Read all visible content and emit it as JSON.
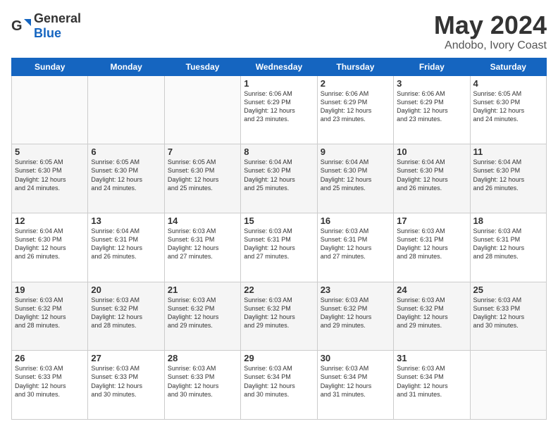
{
  "logo": {
    "general": "General",
    "blue": "Blue"
  },
  "header": {
    "month": "May 2024",
    "location": "Andobo, Ivory Coast"
  },
  "weekdays": [
    "Sunday",
    "Monday",
    "Tuesday",
    "Wednesday",
    "Thursday",
    "Friday",
    "Saturday"
  ],
  "weeks": [
    [
      {
        "num": "",
        "info": ""
      },
      {
        "num": "",
        "info": ""
      },
      {
        "num": "",
        "info": ""
      },
      {
        "num": "1",
        "info": "Sunrise: 6:06 AM\nSunset: 6:29 PM\nDaylight: 12 hours\nand 23 minutes."
      },
      {
        "num": "2",
        "info": "Sunrise: 6:06 AM\nSunset: 6:29 PM\nDaylight: 12 hours\nand 23 minutes."
      },
      {
        "num": "3",
        "info": "Sunrise: 6:06 AM\nSunset: 6:29 PM\nDaylight: 12 hours\nand 23 minutes."
      },
      {
        "num": "4",
        "info": "Sunrise: 6:05 AM\nSunset: 6:30 PM\nDaylight: 12 hours\nand 24 minutes."
      }
    ],
    [
      {
        "num": "5",
        "info": "Sunrise: 6:05 AM\nSunset: 6:30 PM\nDaylight: 12 hours\nand 24 minutes."
      },
      {
        "num": "6",
        "info": "Sunrise: 6:05 AM\nSunset: 6:30 PM\nDaylight: 12 hours\nand 24 minutes."
      },
      {
        "num": "7",
        "info": "Sunrise: 6:05 AM\nSunset: 6:30 PM\nDaylight: 12 hours\nand 25 minutes."
      },
      {
        "num": "8",
        "info": "Sunrise: 6:04 AM\nSunset: 6:30 PM\nDaylight: 12 hours\nand 25 minutes."
      },
      {
        "num": "9",
        "info": "Sunrise: 6:04 AM\nSunset: 6:30 PM\nDaylight: 12 hours\nand 25 minutes."
      },
      {
        "num": "10",
        "info": "Sunrise: 6:04 AM\nSunset: 6:30 PM\nDaylight: 12 hours\nand 26 minutes."
      },
      {
        "num": "11",
        "info": "Sunrise: 6:04 AM\nSunset: 6:30 PM\nDaylight: 12 hours\nand 26 minutes."
      }
    ],
    [
      {
        "num": "12",
        "info": "Sunrise: 6:04 AM\nSunset: 6:30 PM\nDaylight: 12 hours\nand 26 minutes."
      },
      {
        "num": "13",
        "info": "Sunrise: 6:04 AM\nSunset: 6:31 PM\nDaylight: 12 hours\nand 26 minutes."
      },
      {
        "num": "14",
        "info": "Sunrise: 6:03 AM\nSunset: 6:31 PM\nDaylight: 12 hours\nand 27 minutes."
      },
      {
        "num": "15",
        "info": "Sunrise: 6:03 AM\nSunset: 6:31 PM\nDaylight: 12 hours\nand 27 minutes."
      },
      {
        "num": "16",
        "info": "Sunrise: 6:03 AM\nSunset: 6:31 PM\nDaylight: 12 hours\nand 27 minutes."
      },
      {
        "num": "17",
        "info": "Sunrise: 6:03 AM\nSunset: 6:31 PM\nDaylight: 12 hours\nand 28 minutes."
      },
      {
        "num": "18",
        "info": "Sunrise: 6:03 AM\nSunset: 6:31 PM\nDaylight: 12 hours\nand 28 minutes."
      }
    ],
    [
      {
        "num": "19",
        "info": "Sunrise: 6:03 AM\nSunset: 6:32 PM\nDaylight: 12 hours\nand 28 minutes."
      },
      {
        "num": "20",
        "info": "Sunrise: 6:03 AM\nSunset: 6:32 PM\nDaylight: 12 hours\nand 28 minutes."
      },
      {
        "num": "21",
        "info": "Sunrise: 6:03 AM\nSunset: 6:32 PM\nDaylight: 12 hours\nand 29 minutes."
      },
      {
        "num": "22",
        "info": "Sunrise: 6:03 AM\nSunset: 6:32 PM\nDaylight: 12 hours\nand 29 minutes."
      },
      {
        "num": "23",
        "info": "Sunrise: 6:03 AM\nSunset: 6:32 PM\nDaylight: 12 hours\nand 29 minutes."
      },
      {
        "num": "24",
        "info": "Sunrise: 6:03 AM\nSunset: 6:32 PM\nDaylight: 12 hours\nand 29 minutes."
      },
      {
        "num": "25",
        "info": "Sunrise: 6:03 AM\nSunset: 6:33 PM\nDaylight: 12 hours\nand 30 minutes."
      }
    ],
    [
      {
        "num": "26",
        "info": "Sunrise: 6:03 AM\nSunset: 6:33 PM\nDaylight: 12 hours\nand 30 minutes."
      },
      {
        "num": "27",
        "info": "Sunrise: 6:03 AM\nSunset: 6:33 PM\nDaylight: 12 hours\nand 30 minutes."
      },
      {
        "num": "28",
        "info": "Sunrise: 6:03 AM\nSunset: 6:33 PM\nDaylight: 12 hours\nand 30 minutes."
      },
      {
        "num": "29",
        "info": "Sunrise: 6:03 AM\nSunset: 6:34 PM\nDaylight: 12 hours\nand 30 minutes."
      },
      {
        "num": "30",
        "info": "Sunrise: 6:03 AM\nSunset: 6:34 PM\nDaylight: 12 hours\nand 31 minutes."
      },
      {
        "num": "31",
        "info": "Sunrise: 6:03 AM\nSunset: 6:34 PM\nDaylight: 12 hours\nand 31 minutes."
      },
      {
        "num": "",
        "info": ""
      }
    ]
  ]
}
